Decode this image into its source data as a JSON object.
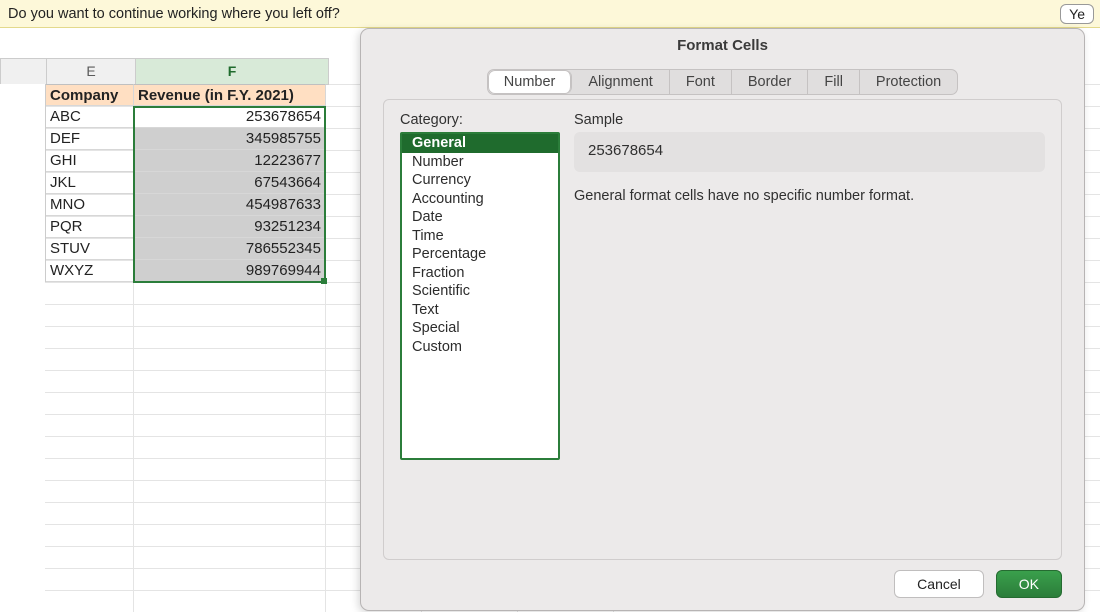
{
  "info_bar": {
    "message": "Do you want to continue working where you left off?",
    "yes_label": "Ye"
  },
  "columns": {
    "E": "E",
    "F": "F"
  },
  "table": {
    "headers": {
      "company": "Company",
      "revenue": "Revenue (in F.Y. 2021)"
    },
    "rows": [
      {
        "company": "ABC",
        "revenue": "253678654"
      },
      {
        "company": "DEF",
        "revenue": "345985755"
      },
      {
        "company": "GHI",
        "revenue": "12223677"
      },
      {
        "company": "JKL",
        "revenue": "67543664"
      },
      {
        "company": "MNO",
        "revenue": "454987633"
      },
      {
        "company": "PQR",
        "revenue": "93251234"
      },
      {
        "company": "STUV",
        "revenue": "786552345"
      },
      {
        "company": "WXYZ",
        "revenue": "989769944"
      }
    ]
  },
  "dialog": {
    "title": "Format Cells",
    "tabs": {
      "number": "Number",
      "alignment": "Alignment",
      "font": "Font",
      "border": "Border",
      "fill": "Fill",
      "protection": "Protection"
    },
    "category_label": "Category:",
    "sample_label": "Sample",
    "categories": [
      "General",
      "Number",
      "Currency",
      "Accounting",
      "Date",
      "Time",
      "Percentage",
      "Fraction",
      "Scientific",
      "Text",
      "Special",
      "Custom"
    ],
    "selected_category": "General",
    "sample_value": "253678654",
    "description": "General format cells have no specific number format.",
    "cancel_label": "Cancel",
    "ok_label": "OK"
  }
}
